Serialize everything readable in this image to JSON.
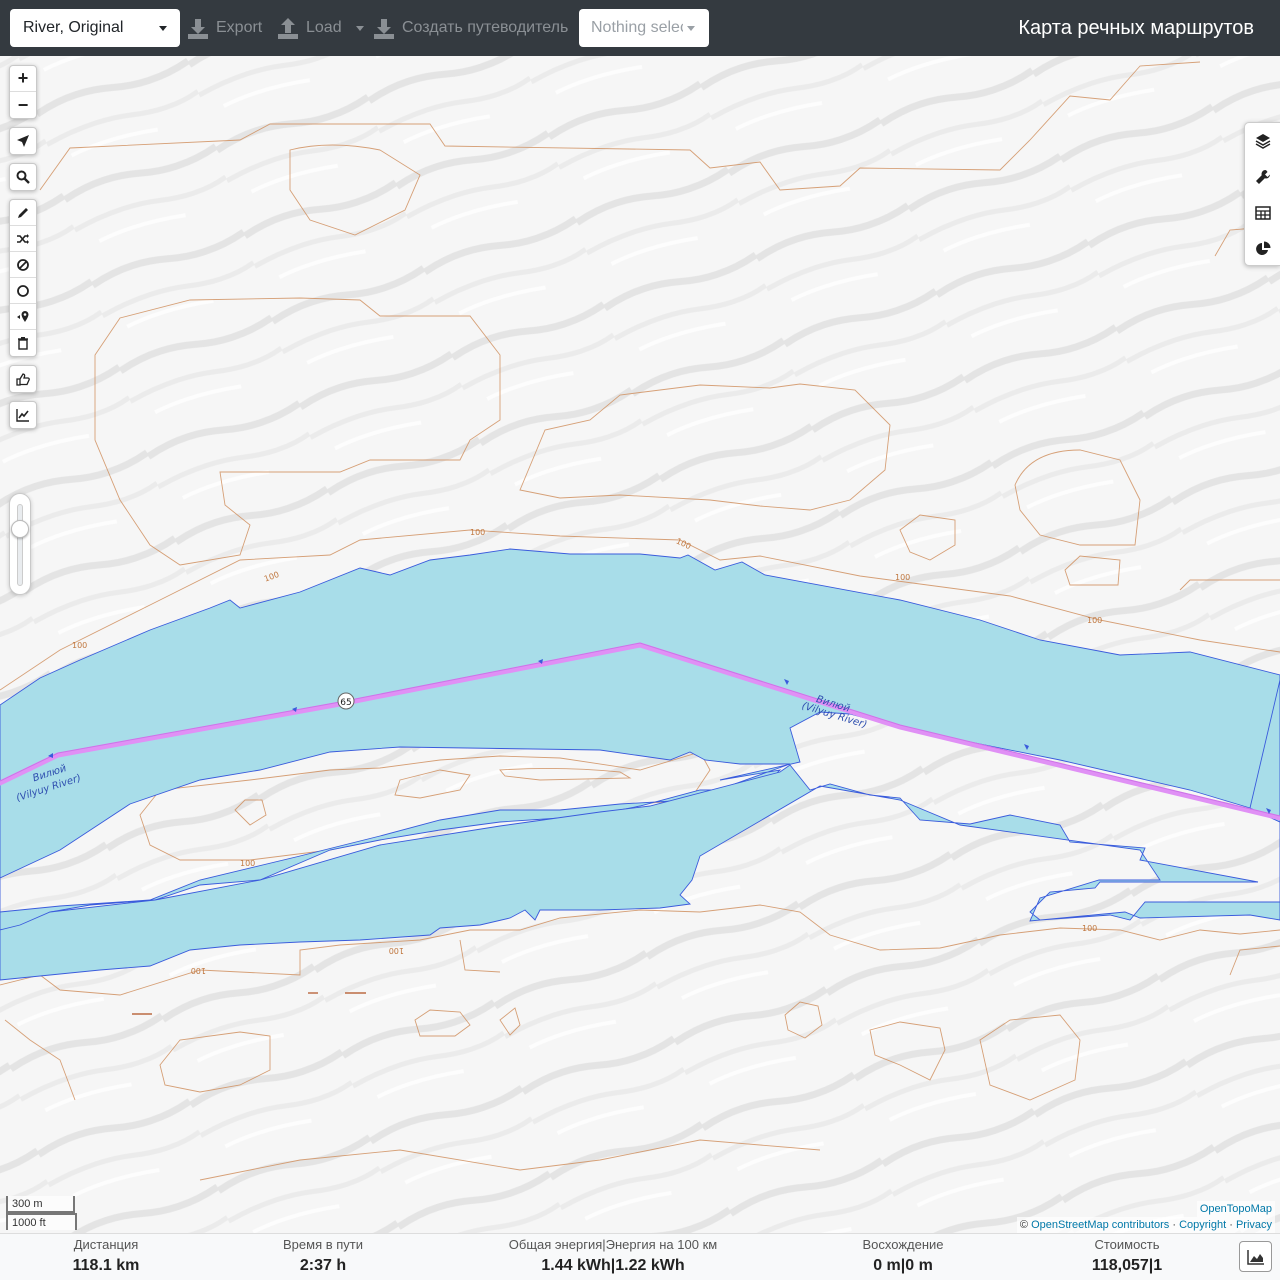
{
  "navbar": {
    "profile": "River, Original",
    "export_label": "Export",
    "load_label": "Load",
    "guide_label": "Создать путеводитель",
    "route_select": "Nothing selected",
    "title": "Карта речных маршрутов"
  },
  "map": {
    "river_label_line1": "Вилюй",
    "river_label_line2": "(Vilyuy River)",
    "road_badge": "65",
    "contour_label": "100",
    "colors": {
      "water": "#aadde8",
      "water_edge": "#3a5bdc",
      "route": "#d480f0",
      "contour": "#c8824a"
    }
  },
  "scale": {
    "metric": "300 m",
    "imperial": "1000 ft"
  },
  "attribution": {
    "tiles": "OpenTopoMap",
    "copy": "©",
    "osm": "OpenStreetMap contributors",
    "sep1": "·",
    "copyright": "Copyright",
    "sep2": "·",
    "privacy": "Privacy"
  },
  "stats": {
    "distance_label": "Дистанция",
    "distance_value": "118.1 km",
    "time_label": "Время в пути",
    "time_value": "2:37 h",
    "energy_label": "Общая энергия|Энергия на 100 км",
    "energy_value": "1.44 kWh|1.22 kWh",
    "ascent_label": "Восхождение",
    "ascent_value": "0 m|0 m",
    "cost_label": "Стоимость",
    "cost_value": "118,057|1"
  },
  "icons": [
    "zoom-in-icon",
    "zoom-out-icon",
    "locate-icon",
    "search-icon",
    "draw-icon",
    "shuffle-icon",
    "nogo-icon",
    "circle-icon",
    "poi-icon",
    "trash-icon",
    "thumb-icon",
    "elevation-icon",
    "layers-icon",
    "wrench-icon",
    "table-icon",
    "pie-icon",
    "download-icon",
    "upload-icon",
    "chart-icon"
  ]
}
